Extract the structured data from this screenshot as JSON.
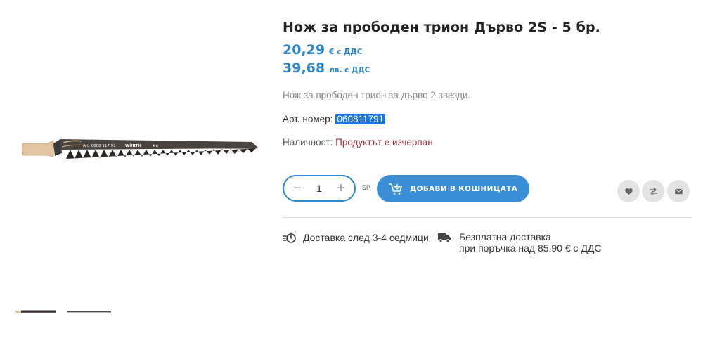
{
  "product": {
    "title": "Нож за прободен трион Дърво 2S - 5 бр.",
    "price_eur": "20,29",
    "price_eur_unit": "€ с ДДС",
    "price_bgn": "39,68",
    "price_bgn_unit": "лв. с ДДС",
    "description": "Нож за прободен трион за дърво 2 звезди.",
    "article_label": "Арт. номер:",
    "article_number": "060811791",
    "availability_label": "Наличност:",
    "availability_status": "Продуктът е изчерпан",
    "image_text": {
      "art": "Art. 0608 117 91",
      "brand": "WÜRTH",
      "stars": "★★"
    }
  },
  "purchase": {
    "quantity": "1",
    "unit": "БР",
    "decrement_symbol": "−",
    "increment_symbol": "+",
    "add_to_cart_label": "ДОБАВИ В КОШНИЦАТА"
  },
  "actions": {
    "icons": [
      "heart-icon",
      "compare-icon",
      "email-icon"
    ]
  },
  "delivery": {
    "time_text": "Доставка след 3-4 седмици",
    "free_line1": "Безплатна доставка",
    "free_line2": "при поръчка над 85.90 € с ДДС"
  },
  "colors": {
    "accent": "#2f86cc",
    "cart_button": "#3a8ed6",
    "out_of_stock": "#a3313a",
    "selection": "#1a73e8"
  }
}
